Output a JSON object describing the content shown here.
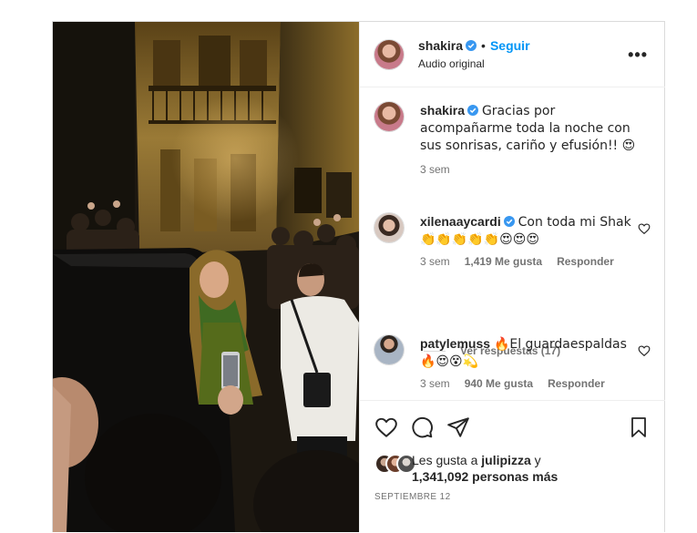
{
  "post": {
    "author": "shakira",
    "follow_label": "Seguir",
    "separator": "•",
    "audio_label": "Audio original",
    "more_label": "•••"
  },
  "caption": {
    "user": "shakira",
    "text": "Gracias por acompañarme toda la noche con sus sonrisas, cariño y efusión!! 😍",
    "time": "3 sem"
  },
  "comments": [
    {
      "user": "xilenaaycardi",
      "text": "Con toda mi Shak 👏👏👏👏👏😍😍😍",
      "time": "3 sem",
      "likes": "1,419 Me gusta",
      "reply_label": "Responder"
    },
    {
      "user": "patylemuss",
      "text": "🔥El guardaespaldas 🔥😍😵💫",
      "time": "3 sem",
      "likes": "940 Me gusta",
      "reply_label": "Responder"
    }
  ],
  "view_replies": "Ver respuestas (17)",
  "likes": {
    "prefix": "Les gusta a ",
    "user": "julipizza",
    "mid": " y",
    "count": "1,341,092 personas más"
  },
  "date": "SEPTIEMBRE 12",
  "icons": [
    "heart-icon",
    "comment-icon",
    "share-icon",
    "bookmark-icon",
    "verified-icon",
    "more-icon"
  ],
  "colors": {
    "accent": "#0095f6",
    "verified": "#3897f0",
    "muted": "#737373",
    "border": "#dbdbdb"
  }
}
